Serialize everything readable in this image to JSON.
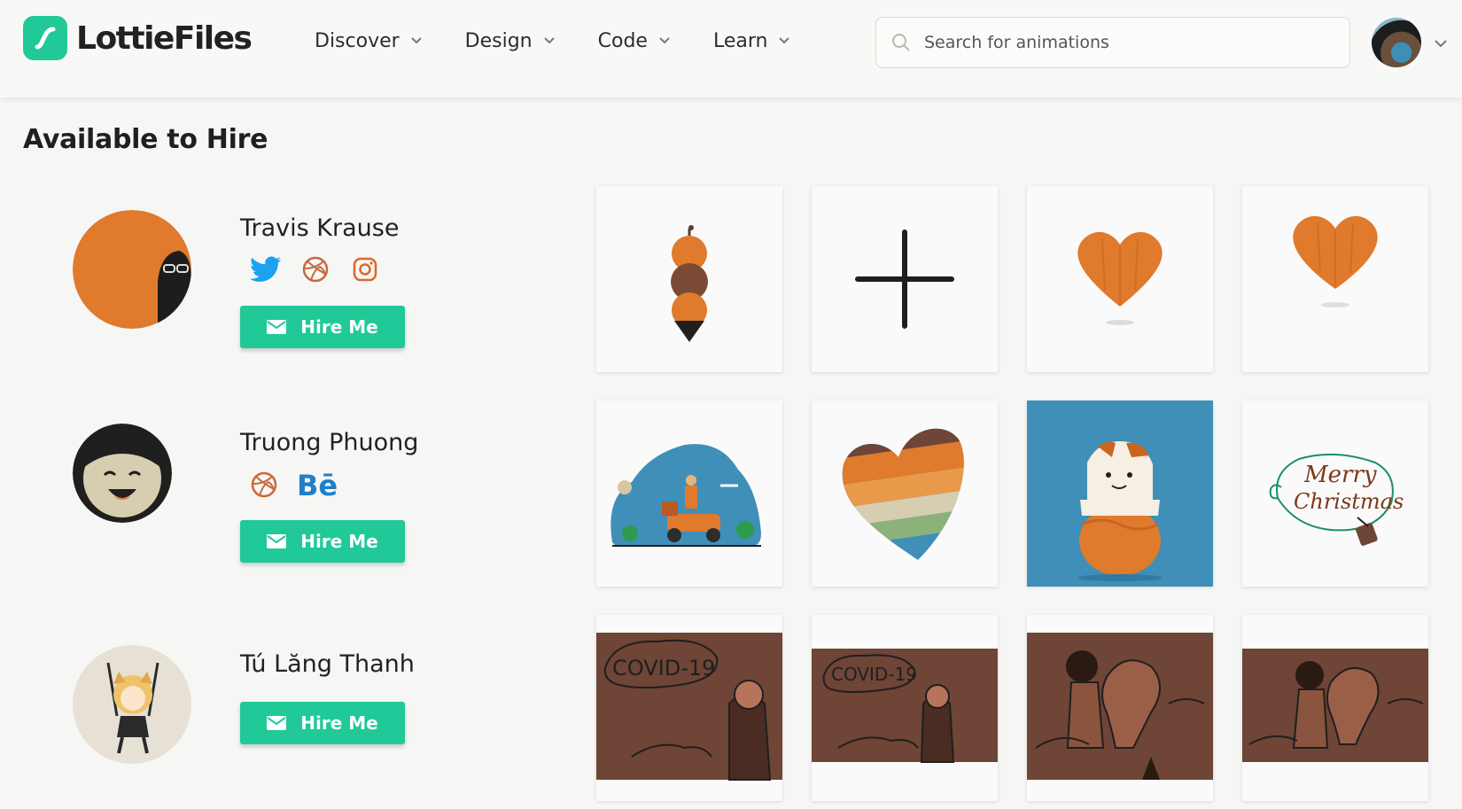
{
  "header": {
    "brand": "LottieFiles",
    "nav": [
      {
        "label": "Discover"
      },
      {
        "label": "Design"
      },
      {
        "label": "Code"
      },
      {
        "label": "Learn"
      }
    ],
    "search_placeholder": "Search for animations",
    "icons": {
      "search": "search-icon",
      "caret": "chevron-down-icon"
    }
  },
  "section": {
    "title": "Available to Hire"
  },
  "creators": [
    {
      "name": "Travis Krause",
      "socials": [
        "twitter-icon",
        "dribbble-icon",
        "instagram-icon"
      ],
      "hire_label": "Hire Me",
      "animations": [
        "stacked-balls-animation",
        "plus-sign-animation",
        "heart-animation",
        "heart-animation"
      ]
    },
    {
      "name": "Truong Phuong",
      "socials": [
        "dribbble-icon",
        "behance-icon"
      ],
      "hire_label": "Hire Me",
      "animations": [
        "scooter-delivery-animation",
        "rainbow-heart-animation",
        "egg-chick-animation",
        "merry-christmas-animation"
      ]
    },
    {
      "name": "Tú Lăng Thanh",
      "socials": [],
      "hire_label": "Hire Me",
      "animations": [
        "covid-19-animation",
        "covid-19-animation",
        "hugging-lightbulb-animation",
        "hugging-lightbulb-animation"
      ]
    }
  ],
  "colors": {
    "accent": "#20c997",
    "orange": "#e07a2c",
    "brown": "#6e4536",
    "blue": "#3f8fb9"
  }
}
